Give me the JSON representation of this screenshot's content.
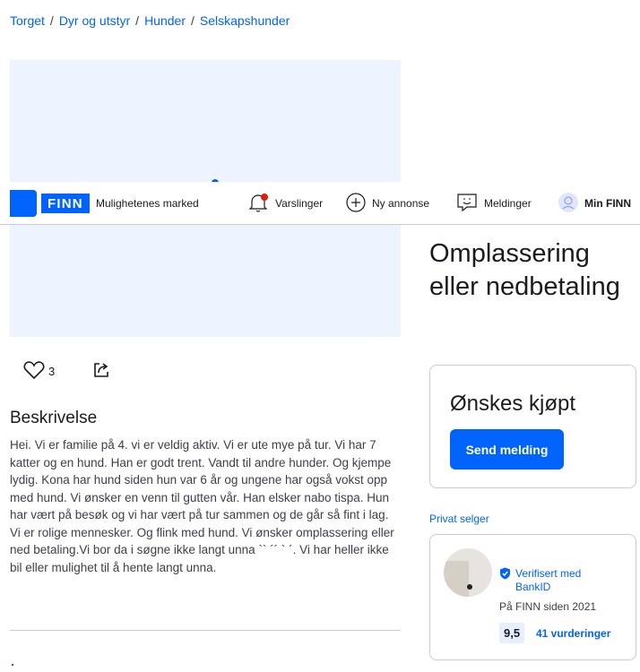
{
  "breadcrumb": {
    "items": [
      "Torget",
      "Dyr og utstyr",
      "Hunder",
      "Selskapshunder"
    ],
    "separator": "/"
  },
  "navbar": {
    "logo_text": "FINN",
    "tagline": "Mulighetenes marked",
    "items": [
      {
        "label": "Varslinger",
        "icon": "bell-icon"
      },
      {
        "label": "Ny annonse",
        "icon": "plus-circle-icon"
      },
      {
        "label": "Meldinger",
        "icon": "message-icon"
      },
      {
        "label": "Min FINN",
        "icon": "user-avatar-icon"
      }
    ]
  },
  "ad": {
    "title": "Omplassering eller nedbetaling",
    "likes": "3",
    "description_heading": "Beskrivelse",
    "description": "Hei. Vi er familie på 4. vi er veldig aktiv. Vi er ute mye på tur. Vi har 7 katter og en hund. Han er godt trent. Vandt til andre hunder. Og kjempe lydig. Kona har hund siden hun var 6 år og ungene har også vokst opp med hund. Vi ønsker en venn til gutten vår. Han elsker nabo tispa. Hun har vært på besøk og vi har vært på tur sammen og de går så fint i lag. Vi er rolige mennesker. Og flink med hund. Vi ønsker omplassering eller ned betaling.Vi bor da i søgne ikke langt unna `` ´´ ` ´. Vi har heller ikke bil eller mulighet til å hente langt unna."
  },
  "buy_box": {
    "heading": "Ønskes kjøpt",
    "button_label": "Send melding"
  },
  "seller": {
    "label": "Privat selger",
    "verified": "Verifisert med BankID",
    "since": "På FINN siden 2021",
    "score": "9,5",
    "reviews": "41 vurderinger"
  },
  "colors": {
    "accent": "#0063fb",
    "image_placeholder": "#eef4ff",
    "border": "#c3ccd9",
    "notification_dot": "#d91f0a"
  }
}
